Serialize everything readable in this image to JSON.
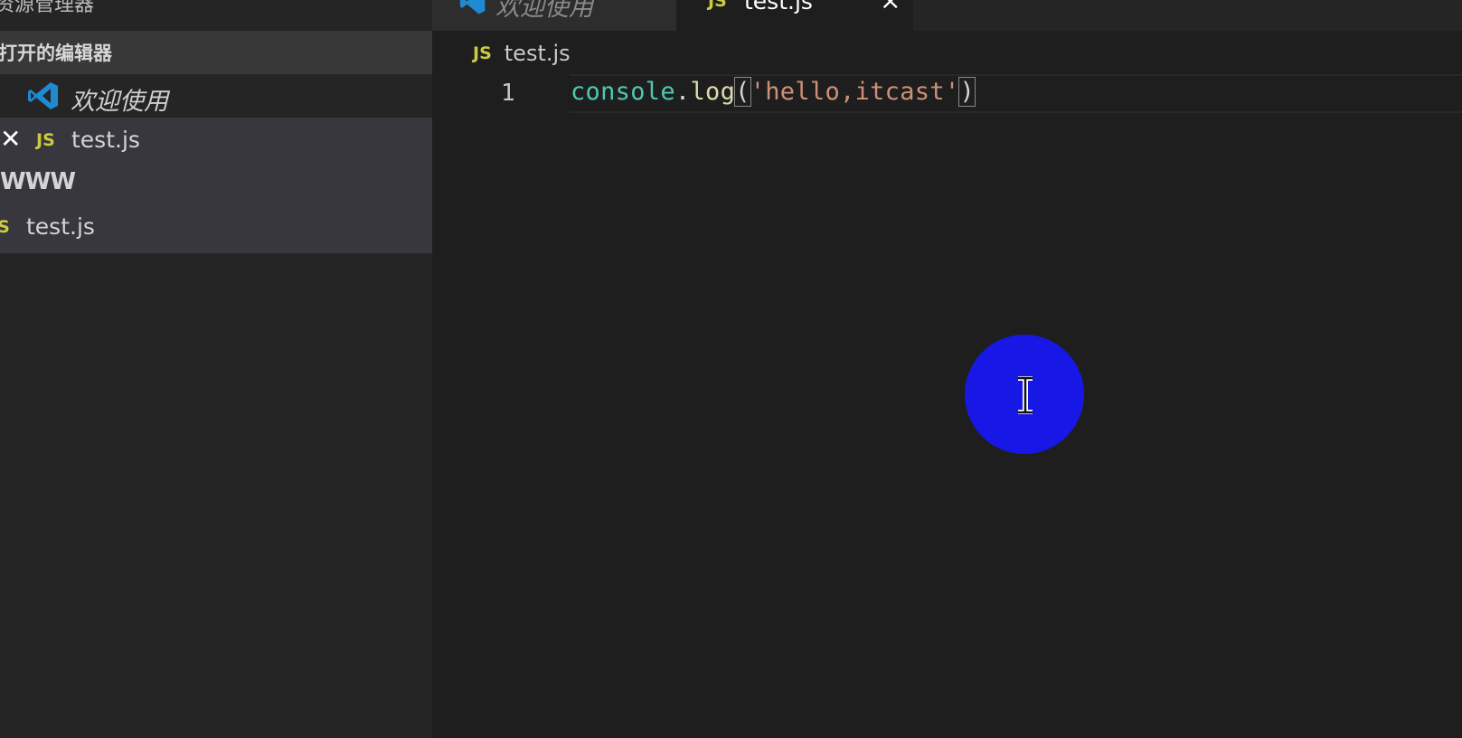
{
  "sidebar": {
    "title": "资源管理器",
    "open_editors_header": "打开的编辑器",
    "open_editors": [
      {
        "label": "欢迎使用",
        "icon": "vscode-icon"
      },
      {
        "label": "test.js",
        "icon": "js-icon",
        "badge": "JS",
        "close": "✕"
      }
    ],
    "folder": {
      "label": "WWW"
    },
    "files": [
      {
        "label": "test.js",
        "badge": "JS"
      }
    ]
  },
  "tabs": [
    {
      "label": "欢迎使用",
      "icon": "vscode-icon",
      "active": false
    },
    {
      "label": "test.js",
      "badge": "JS",
      "close": "×",
      "active": true
    }
  ],
  "breadcrumb": {
    "badge": "JS",
    "label": "test.js"
  },
  "editor": {
    "line_numbers": [
      "1"
    ],
    "code": {
      "object": "console",
      "dot": ".",
      "method": "log",
      "open_paren": "(",
      "string": "'hello,itcast'",
      "close_paren": ")"
    }
  },
  "colors": {
    "background": "#1e1e1e",
    "sidebar": "#252526",
    "js_badge": "#cbcb41",
    "cursor_highlight": "#1818e6"
  },
  "icons": [
    "vscode-icon",
    "js-icon",
    "close-icon",
    "text-cursor-icon"
  ]
}
